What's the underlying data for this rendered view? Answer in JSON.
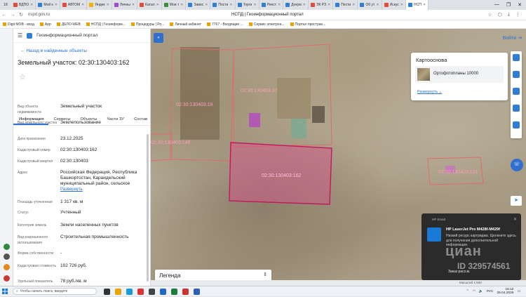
{
  "browser": {
    "tab_count": "18",
    "tabs": [
      {
        "label": "ВДПО",
        "color": "#e34c3c"
      },
      {
        "label": "Мой к",
        "color": "#2f7fd7"
      },
      {
        "label": "АВТОМ",
        "color": "#e34c3c"
      },
      {
        "label": "Яндек",
        "color": "#f0b400"
      },
      {
        "label": "Личны",
        "color": "#9b4bd0"
      },
      {
        "label": "Катал",
        "color": "#e34c3c"
      },
      {
        "label": "Мои т",
        "color": "#3d8f3d"
      },
      {
        "label": "Завис",
        "color": "#2f7fd7"
      },
      {
        "label": "Пости",
        "color": "#2f7fd7"
      },
      {
        "label": "Торги",
        "color": "#2f7fd7"
      },
      {
        "label": "Реест",
        "color": "#2f7fd7"
      },
      {
        "label": "Докум",
        "color": "#2f7fd7"
      },
      {
        "label": "ЭК РЗ",
        "color": "#e34c3c"
      },
      {
        "label": "Пости",
        "color": "#2f7fd7"
      },
      {
        "label": "Об ут",
        "color": "#2f7fd7"
      },
      {
        "label": "Искус",
        "color": "#e34c3c"
      },
      {
        "label": "НСП",
        "color": "#2f7fd7"
      }
    ],
    "url": "nspd.gov.ru",
    "page_title": "НСПД | Геоинформационный портал",
    "bookmarks": [
      "Digit MOB - вход",
      "App",
      "ДЕЛО-WEB",
      "НСПД | Геоинформ...",
      "Процедуры | Ро...",
      "Личный кабинет",
      "7767 - Входящие ...",
      "Сервис электрон...",
      "Портал простран..."
    ]
  },
  "panel": {
    "portal_title": "Геоинформационный портал",
    "back_link": "Назад в найденные объекты",
    "title": "Земельный участок: 02:30:130403:162",
    "tabs": [
      "Информация",
      "Сервисы",
      "Объекты",
      "Части ЗУ",
      "Состав"
    ],
    "rows": [
      {
        "k": "Вид объекта недвижимости",
        "v": "Земельный участок"
      },
      {
        "k": "Вид земельного участка",
        "v": "Землепользование"
      },
      {
        "k": "Дата присвоения",
        "v": "23.12.2025"
      },
      {
        "k": "Кадастровый номер",
        "v": "02:30:130403:162"
      },
      {
        "k": "Кадастровый квартал",
        "v": "02:30:130403"
      },
      {
        "k": "Адрес",
        "v": "Российская Федерация, Республика Башкортостан, Караидельский муниципальный район, сельское",
        "link": "Развернуть"
      },
      {
        "k": "Площадь уточненная",
        "v": "1 317 кв. м"
      },
      {
        "k": "Статус",
        "v": "Учтенный"
      },
      {
        "k": "Категория земель",
        "v": "Земли населенных пунктов"
      },
      {
        "k": "Вид разрешенного использования",
        "v": "Строительная промышленность"
      },
      {
        "k": "Форма собственности",
        "v": "-"
      },
      {
        "k": "Кадастровая стоимость",
        "v": "102 726 руб."
      },
      {
        "k": "Удельный показатель",
        "v": "78 руб./кв. м"
      }
    ]
  },
  "map": {
    "login": "Войти",
    "basemap_title": "Картооснова",
    "basemap_item": "Ортофотопланы 10000",
    "basemap_switch": "Развернуть",
    "legend": "Легенда",
    "parcel_labels": [
      "02:30:130403:37",
      "02:30:130403:18",
      "02:30:130403:148",
      "02:30:130403:162",
      "02:30:130403:131"
    ],
    "status_text": "Масштаб 1:500"
  },
  "notification": {
    "app": "HP Smart",
    "title": "HP LaserJet Pro M428f-M429f",
    "body": "Низкий ресурс картриджа. Щелкните здесь для получения дополнительной информации.",
    "action": "Заказ расх.м.",
    "watermark": "циан",
    "watermark_id": "ID 329574561"
  },
  "taskbar": {
    "search_placeholder": "Чтобы начать поиск, введите",
    "lang": "РУС",
    "time": "18:12",
    "date": "29.04.2026"
  }
}
